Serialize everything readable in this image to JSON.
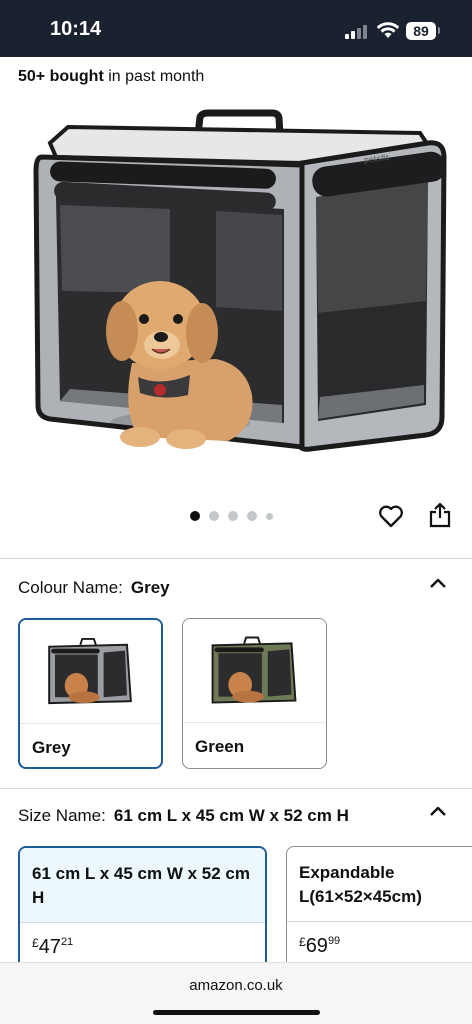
{
  "status_bar": {
    "time": "10:14",
    "battery": "89"
  },
  "product": {
    "bought_bold": "50+ bought",
    "bought_rest": " in past month",
    "image_icon": "pet-crate-with-dog-image",
    "carousel": {
      "count": 5,
      "active_index": 0
    }
  },
  "colour": {
    "label": "Colour Name:",
    "value": "Grey",
    "options": [
      {
        "label": "Grey",
        "selected": true,
        "frame_color": "#9a9ea3"
      },
      {
        "label": "Green",
        "selected": false,
        "frame_color": "#6e7a55"
      }
    ]
  },
  "size": {
    "label": "Size Name:",
    "value": "61 cm L x 45 cm W x 52 cm H",
    "options": [
      {
        "label": "61 cm L x 45 cm W x 52 cm H",
        "currency": "£",
        "price_whole": "47",
        "price_fraction": "21",
        "selected": true
      },
      {
        "label": "Expandable L(61×52×45cm)",
        "currency": "£",
        "price_whole": "69",
        "price_fraction": "99",
        "selected": false
      }
    ]
  },
  "browser": {
    "url": "amazon.co.uk"
  },
  "colors": {
    "status_bar": "#1a2230",
    "selected_border": "#1f5b96",
    "selected_fill": "#edf8fd"
  }
}
